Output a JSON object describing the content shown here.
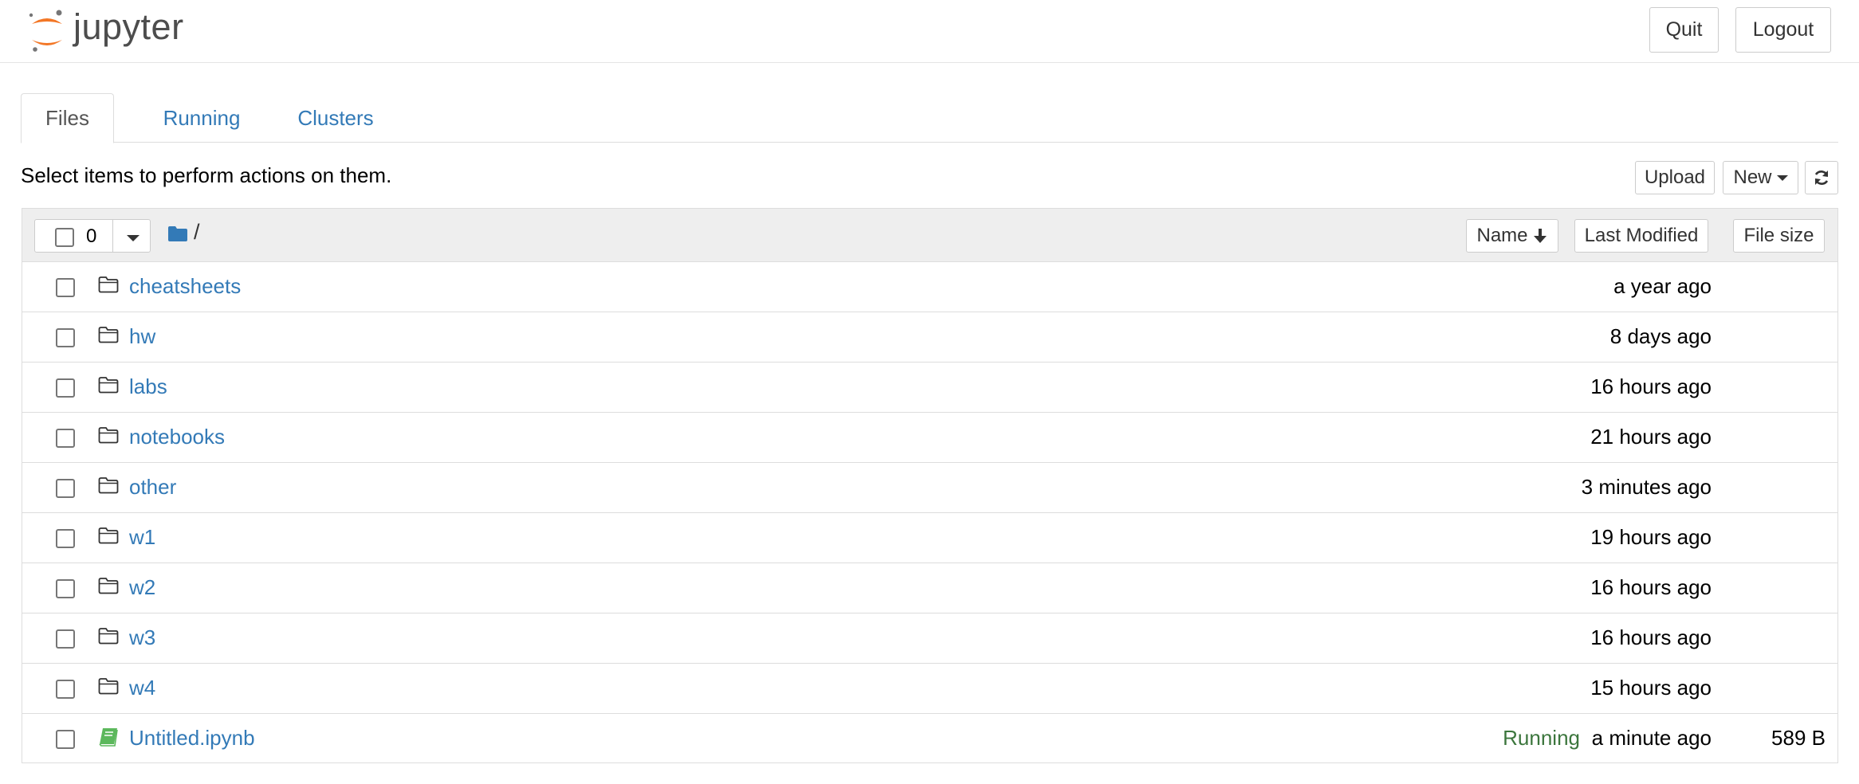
{
  "header": {
    "logo_text": "jupyter",
    "quit_label": "Quit",
    "logout_label": "Logout",
    "logo_colors": {
      "orange": "#F37726",
      "gray": "#767677"
    }
  },
  "tabs": [
    {
      "label": "Files",
      "active": true
    },
    {
      "label": "Running",
      "active": false
    },
    {
      "label": "Clusters",
      "active": false
    }
  ],
  "instructions": "Select items to perform actions on them.",
  "toolbar": {
    "upload_label": "Upload",
    "new_label": "New",
    "refresh_icon": "refresh-icon"
  },
  "list_header": {
    "selected_count": "0",
    "breadcrumb": "/",
    "sort_name_label": "Name",
    "sort_modified_label": "Last Modified",
    "sort_size_label": "File size"
  },
  "files": [
    {
      "name": "cheatsheets",
      "type": "folder",
      "modified": "a year ago",
      "status": "",
      "size": ""
    },
    {
      "name": "hw",
      "type": "folder",
      "modified": "8 days ago",
      "status": "",
      "size": ""
    },
    {
      "name": "labs",
      "type": "folder",
      "modified": "16 hours ago",
      "status": "",
      "size": ""
    },
    {
      "name": "notebooks",
      "type": "folder",
      "modified": "21 hours ago",
      "status": "",
      "size": ""
    },
    {
      "name": "other",
      "type": "folder",
      "modified": "3 minutes ago",
      "status": "",
      "size": ""
    },
    {
      "name": "w1",
      "type": "folder",
      "modified": "19 hours ago",
      "status": "",
      "size": ""
    },
    {
      "name": "w2",
      "type": "folder",
      "modified": "16 hours ago",
      "status": "",
      "size": ""
    },
    {
      "name": "w3",
      "type": "folder",
      "modified": "16 hours ago",
      "status": "",
      "size": ""
    },
    {
      "name": "w4",
      "type": "folder",
      "modified": "15 hours ago",
      "status": "",
      "size": ""
    },
    {
      "name": "Untitled.ipynb",
      "type": "notebook",
      "modified": "a minute ago",
      "status": "Running",
      "size": "589 B"
    }
  ],
  "colors": {
    "link": "#337ab7",
    "running": "#3c763d",
    "notebook_icon": "#5cb85c"
  }
}
